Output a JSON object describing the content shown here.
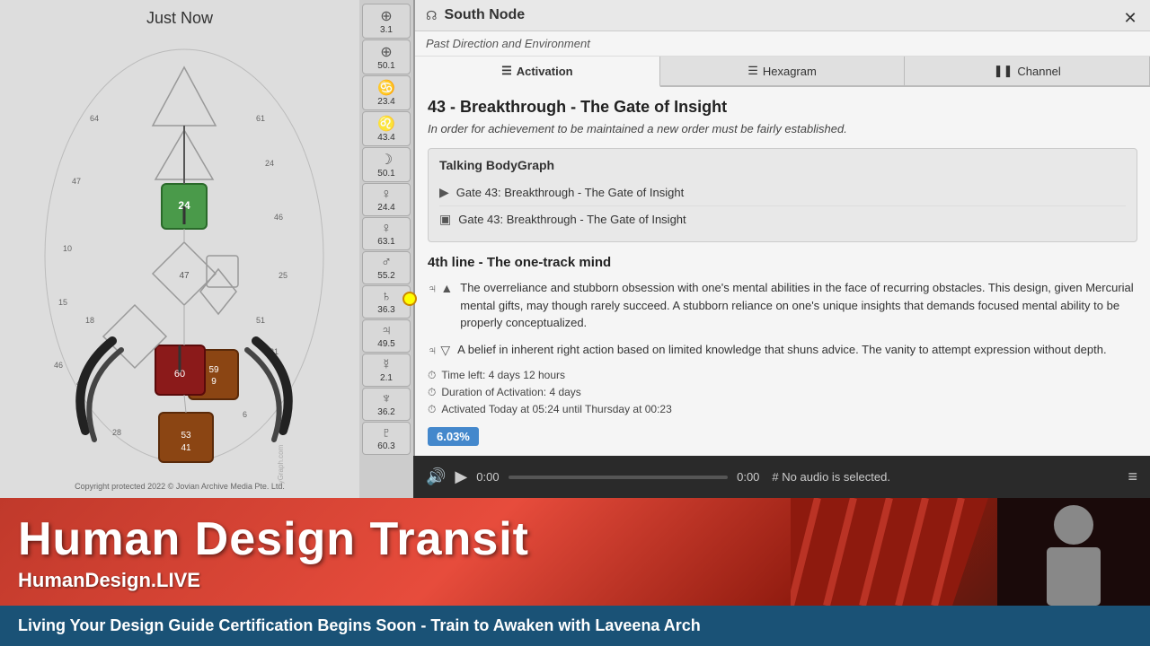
{
  "header": {
    "just_now": "Just Now",
    "panel_title": "South Node",
    "panel_subtitle": "Past Direction and Environment",
    "close_icon": "✕",
    "planet_icon": "☊"
  },
  "tabs": [
    {
      "id": "activation",
      "label": "Activation",
      "icon": "☰",
      "active": true
    },
    {
      "id": "hexagram",
      "label": "Hexagram",
      "icon": "☰",
      "active": false
    },
    {
      "id": "channel",
      "label": "Channel",
      "icon": "❚❚",
      "active": false
    }
  ],
  "gate": {
    "number": "43",
    "name": "Breakthrough",
    "subtitle": "The Gate of Insight",
    "description": "In order for achievement to be maintained a new order must be fairly established."
  },
  "talking_bodygraph": {
    "title": "Talking BodyGraph",
    "rows": [
      {
        "type": "play",
        "icon": "▶",
        "text": "Gate 43: Breakthrough - The Gate of Insight"
      },
      {
        "type": "doc",
        "icon": "▣",
        "text": "Gate 43: Breakthrough - The Gate of Insight"
      }
    ]
  },
  "line": {
    "title": "4th line - The one-track mind",
    "descriptions": [
      {
        "symbol": "♃ ▲",
        "text": "The overreliance and stubborn obsession with one's mental abilities in the face of recurring obstacles. This design, given Mercurial mental gifts, may though rarely succeed. A stubborn reliance on one's unique insights that demands focused mental ability to be properly conceptualized."
      },
      {
        "symbol": "♃ ▽",
        "text": "A belief in inherent right action based on limited knowledge that shuns advice. The vanity to attempt expression without depth."
      }
    ]
  },
  "activation_info": {
    "time_left": "Time left: 4 days 12 hours",
    "duration": "Duration of Activation: 4 days",
    "activated": "Activated Today at 05:24 until Thursday at 00:23",
    "percentage": "6.03%"
  },
  "audio_bar": {
    "volume_icon": "🔊",
    "play_icon": "▶",
    "time_start": "0:00",
    "time_end": "0:00",
    "no_audio": "# No audio is selected.",
    "list_icon": "≡"
  },
  "sidebar_icons": [
    {
      "symbol": "⊕",
      "number": "3.1"
    },
    {
      "symbol": "⊕",
      "number": "50.1"
    },
    {
      "symbol": "♋",
      "number": "23.4"
    },
    {
      "symbol": "♌",
      "number": "43.4"
    },
    {
      "symbol": "☽",
      "number": "50.1"
    },
    {
      "symbol": "♀",
      "number": "24.4"
    },
    {
      "symbol": "♀",
      "number": "63.1"
    },
    {
      "symbol": "♂",
      "number": "55.2"
    },
    {
      "symbol": "♄",
      "number": "36.3"
    },
    {
      "symbol": "♃",
      "number": "49.5"
    },
    {
      "symbol": "☿",
      "number": "2.1"
    },
    {
      "symbol": "♆",
      "number": "36.2"
    },
    {
      "symbol": "♇",
      "number": "60.3"
    }
  ],
  "banner": {
    "title": "Human Design Transit",
    "subtitle": "HumanDesign.LIVE",
    "ticker": "Living Your Design Guide Certification Begins Soon - Train to Awaken with Laveena Arch"
  },
  "copyright": "Copyright protected 2022 © Jovian Archive Media Pte. Ltd."
}
